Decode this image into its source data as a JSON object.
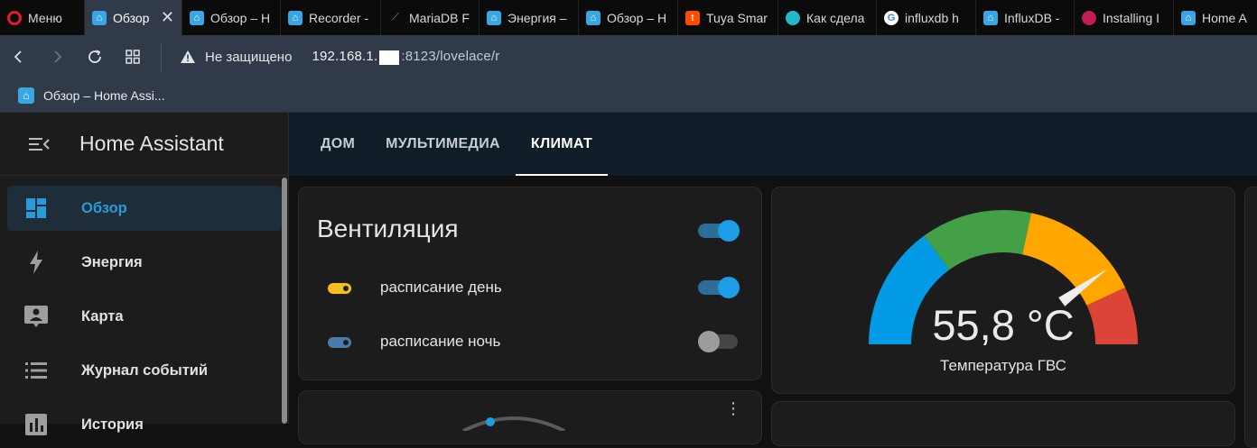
{
  "browser": {
    "tabs": [
      {
        "label": "Меню",
        "icon": "opera-icon"
      },
      {
        "label": "Обзор",
        "icon": "home-assistant-icon",
        "active": true
      },
      {
        "label": "Обзор – H",
        "icon": "home-assistant-icon"
      },
      {
        "label": "Recorder -",
        "icon": "home-assistant-icon"
      },
      {
        "label": "MariaDB F",
        "icon": "mariadb-icon"
      },
      {
        "label": "Энергия –",
        "icon": "home-assistant-icon"
      },
      {
        "label": "Обзор – H",
        "icon": "home-assistant-icon"
      },
      {
        "label": "Tuya Smar",
        "icon": "tuya-icon"
      },
      {
        "label": "Как сдела",
        "icon": "chat-icon"
      },
      {
        "label": "influxdb h",
        "icon": "google-icon"
      },
      {
        "label": "InfluxDB -",
        "icon": "home-assistant-icon"
      },
      {
        "label": "Installing I",
        "icon": "installing-icon"
      },
      {
        "label": "Home A",
        "icon": "home-assistant-icon"
      }
    ],
    "security": "Не защищено",
    "url_prefix": "192.168.1.",
    "url_suffix": ":8123/lovelace/r",
    "bookmark": "Обзор – Home Assi..."
  },
  "sidebar": {
    "title": "Home Assistant",
    "items": [
      {
        "label": "Обзор",
        "icon": "dashboard-icon",
        "active": true
      },
      {
        "label": "Энергия",
        "icon": "lightning-icon"
      },
      {
        "label": "Карта",
        "icon": "map-account-icon"
      },
      {
        "label": "Журнал событий",
        "icon": "logbook-icon"
      },
      {
        "label": "История",
        "icon": "history-chart-icon"
      }
    ]
  },
  "views": [
    {
      "label": "ДОМ"
    },
    {
      "label": "МУЛЬТИМЕДИА"
    },
    {
      "label": "КЛИМАТ",
      "active": true
    }
  ],
  "ventilation_card": {
    "title": "Вентиляция",
    "master_state": "on",
    "rows": [
      {
        "label": "расписание день",
        "state": "on",
        "icon_color": "#f4c01a"
      },
      {
        "label": "расписание ночь",
        "state": "off",
        "icon_color": "#4a7cab"
      }
    ]
  },
  "gauge_card": {
    "value": "55,8 °C",
    "value_number": 55.8,
    "name": "Температура ГВС",
    "colors": {
      "low": "#039be5",
      "mid": "#43a047",
      "high": "#ffa600",
      "crit": "#db4437"
    }
  }
}
